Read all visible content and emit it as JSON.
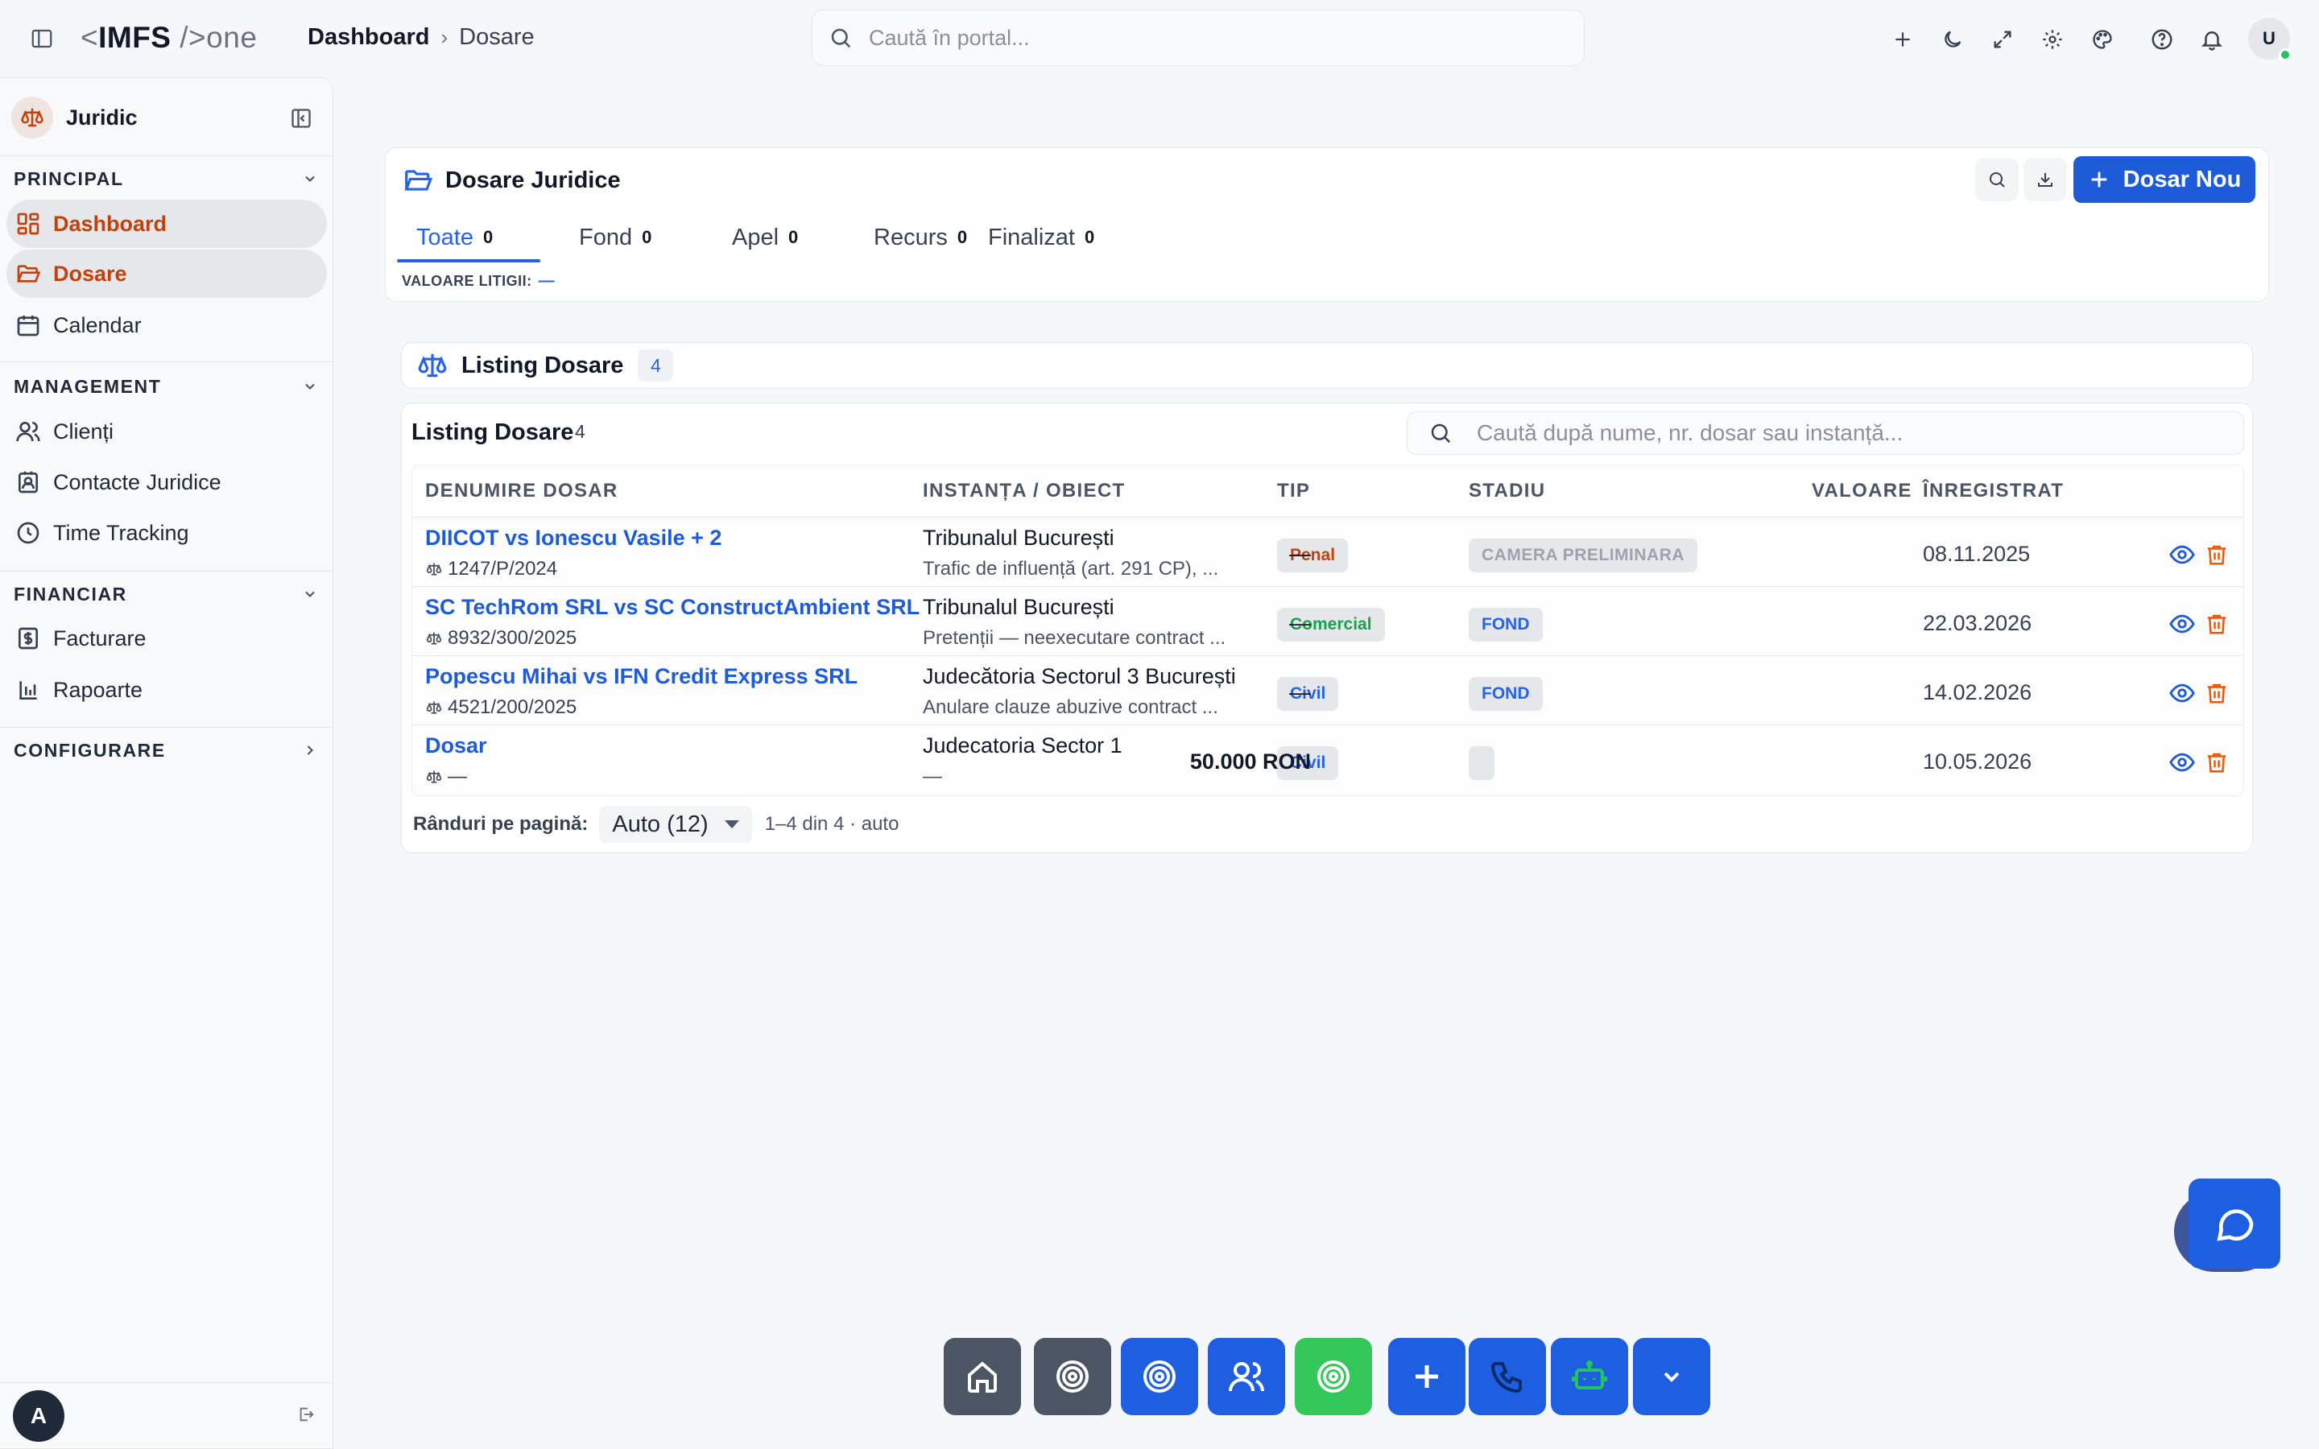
{
  "topbar": {
    "logo": {
      "lt": "<",
      "brand": "IMFS",
      "suffix": " />one"
    },
    "breadcrumb": [
      "Dashboard",
      "Dosare"
    ],
    "search_placeholder": "Caută în portal...",
    "icons": [
      "plus-icon",
      "moon-icon",
      "expand-icon",
      "settings-icon",
      "palette-icon",
      "help-icon",
      "bell-icon"
    ],
    "user_initial": "U"
  },
  "sidebar": {
    "org_name": "Juridic",
    "sections": {
      "principal": "PRINCIPAL",
      "management": "MANAGEMENT",
      "financiar": "FINANCIAR",
      "configurare": "CONFIGURARE"
    },
    "items": {
      "dashboard": "Dashboard",
      "dosare": "Dosare",
      "calendar": "Calendar",
      "clienti": "Clienți",
      "contacte": "Contacte Juridice",
      "time": "Time Tracking",
      "facturare": "Facturare",
      "rapoarte": "Rapoarte"
    },
    "user_initial": "A"
  },
  "case_card": {
    "title": "Dosare Juridice",
    "new_button": "Dosar Nou",
    "tabs": [
      {
        "label": "Toate",
        "count": "0"
      },
      {
        "label": "Fond",
        "count": "0"
      },
      {
        "label": "Apel",
        "count": "0"
      },
      {
        "label": "Recurs",
        "count": "0"
      },
      {
        "label": "Finalizat",
        "count": "0"
      }
    ],
    "value_label": "VALOARE LITIGII:",
    "value": "—"
  },
  "listing_bar": {
    "title": "Listing Dosare",
    "count": "4"
  },
  "table": {
    "title": "Listing Dosare",
    "count": "4",
    "search_placeholder": "Caută după nume, nr. dosar sau instanță...",
    "columns": [
      "DENUMIRE DOSAR",
      "INSTANȚA / OBIECT",
      "TIP",
      "STADIU",
      "VALOARE",
      "ÎNREGISTRAT"
    ],
    "rows": [
      {
        "name": "DIICOT vs Ionescu Vasile + 2",
        "number": "1247/P/2024",
        "court": "Tribunalul București",
        "object": "Trafic de influență (art. 291 CP), ...",
        "type": "Penal",
        "stage": "CAMERA PRELIMINARA",
        "value": "—",
        "date": "08.11.2025"
      },
      {
        "name": "SC TechRom SRL vs SC ConstructAmbient SRL",
        "number": "8932/300/2025",
        "court": "Tribunalul București",
        "object": "Pretenții — neexecutare contract ...",
        "type": "Comercial",
        "stage": "FOND",
        "value": "—",
        "date": "22.03.2026"
      },
      {
        "name": "Popescu Mihai vs IFN Credit Express SRL",
        "number": "4521/200/2025",
        "court": "Judecătoria Sectorul 3 București",
        "object": "Anulare clauze abuzive contract ...",
        "type": "Civil",
        "stage": "FOND",
        "value": "—",
        "date": "14.02.2026"
      },
      {
        "name": "Dosar",
        "number": "—",
        "court": "Judecatoria Sector 1",
        "object": "—",
        "type": "Civil",
        "stage": "",
        "value": "50.000 RON",
        "date": "10.05.2026"
      }
    ],
    "pager": {
      "label": "Rânduri pe pagină:",
      "selected": "Auto (12)",
      "range": "1–4 din 4 · auto"
    }
  },
  "dock": [
    "home-icon",
    "target-icon",
    "target-icon",
    "users-icon",
    "target-icon",
    "plus-icon",
    "phone-icon",
    "robot-icon",
    "chevron-down-icon"
  ],
  "colors": {
    "accent": "#1d5bd8",
    "active_nav": "#c2410c",
    "success": "#22c55e"
  }
}
